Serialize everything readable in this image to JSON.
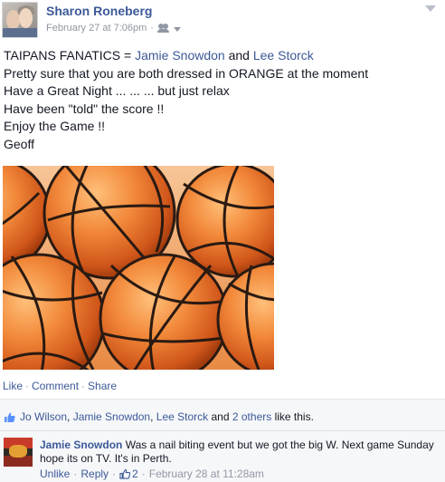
{
  "post": {
    "author": "Sharon Roneberg",
    "timestamp": "February 27 at 7:06pm",
    "audience_icon": "friends-icon",
    "text": {
      "line1_prefix": "TAIPANS FANATICS = ",
      "line1_tag1": "Jamie Snowdon",
      "line1_and": " and ",
      "line1_tag2": "Lee Storck",
      "line2": "Pretty sure that you are both dressed in ORANGE at the moment",
      "line3": "Have a Great Night ... ... ... but just relax",
      "line4": "Have been \"told\" the score !!",
      "line5": "Enjoy the Game !!",
      "line6": "Geoff"
    },
    "photo_subject": "basketballs"
  },
  "actions": {
    "like": "Like",
    "comment": "Comment",
    "share": "Share",
    "separator": "·"
  },
  "likes": {
    "name1": "Jo Wilson",
    "name2": "Jamie Snowdon",
    "name3": "Lee Storck",
    "and_text": "and",
    "others": "2 others",
    "suffix": "like this.",
    "comma": ","
  },
  "comment": {
    "author": "Jamie Snowdon",
    "text": "Was a nail biting event but we got the big W. Next game Sunday hope its on TV. It's in Perth.",
    "unlike": "Unlike",
    "reply": "Reply",
    "like_count": "2",
    "timestamp": "February 28 at 11:28am",
    "separator": "·"
  },
  "colors": {
    "link": "#3b5998",
    "meta": "#9197a3",
    "feedback_bg": "#f6f7f9",
    "ball_orange": "#e97a2d"
  }
}
